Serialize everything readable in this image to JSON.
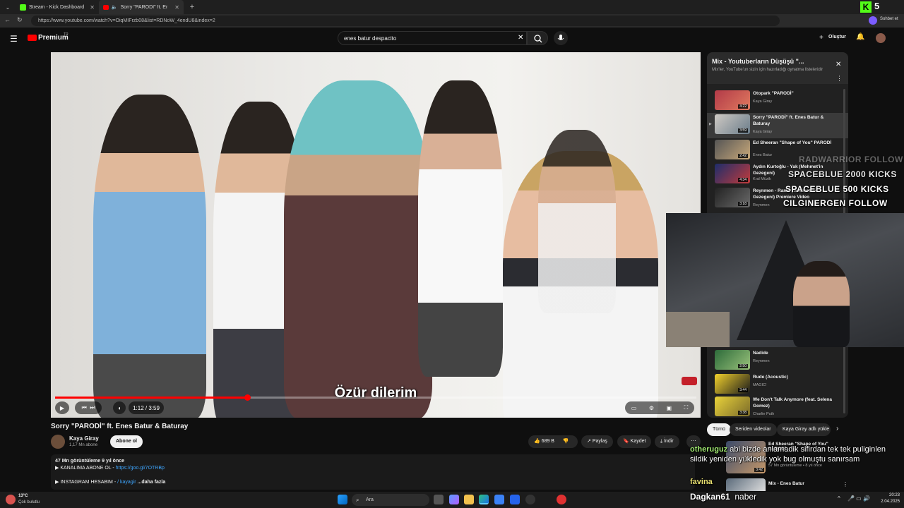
{
  "browser": {
    "tabs": [
      {
        "label": "Stream - Kick Dashboard",
        "active": false
      },
      {
        "label": "Sorry \"PARODİ\" ft. Enes Batur",
        "active": true
      }
    ],
    "url": "https://www.youtube.com/watch?v=OiqMIFrzb08&list=RDNoW_4endU8&index=2",
    "kick_badge": "5",
    "chat_button": "Sohbet et"
  },
  "youtube": {
    "logo": "Premium",
    "logo_sup": "TR",
    "search_value": "enes batur despacito",
    "create_label": "Oluştur"
  },
  "video": {
    "subtitle": "Özür dilerim",
    "time": "1:12 / 3:59",
    "progress_fraction": 0.3,
    "title": "Sorry \"PARODİ\" ft. Enes Batur & Baturay",
    "channel": "Kaya Giray",
    "subscribers": "1,17 Mn abone",
    "subscribe_label": "Abone ol",
    "likes": "689 B",
    "share_label": "Paylaş",
    "save_label": "Kaydet",
    "download_label": "İndir",
    "desc_line1": "47 Mn görüntüleme  9 yıl önce",
    "desc_line2": "▶ KANALIMA ABONE OL - ",
    "desc_link": "https://goo.gl/7OTRBp",
    "desc_line3": "▶ INSTAGRAM HESABIM - ",
    "desc_ig": "/ kayagir",
    "desc_more": "...daha fazla"
  },
  "playlist": {
    "title": "Mix - Youtuberların Düşüşü \"...",
    "subtitle": "Mix'ler, YouTube'un sizin için hazırladığı oynatma listeleridir",
    "items": [
      {
        "title": "Otopark \"PARODİ\"",
        "author": "Kaya Giray",
        "duration": "4:22"
      },
      {
        "title": "Sorry \"PARODİ\" ft. Enes Batur & Baturay",
        "author": "Kaya Giray",
        "duration": "3:59"
      },
      {
        "title": "Ed Sheeran \"Shape of You\" PARODİ",
        "author": "Enes Batur",
        "duration": "2:42"
      },
      {
        "title": "Aydın Kurtoğlu - Yak (Mehmet'in Gezegeni)",
        "author": "Kral Müzik",
        "duration": "4:34"
      },
      {
        "title": "Reynmen - Ramo (Mehmet'in Gezegeni) Premiere Video",
        "author": "Reynmen",
        "duration": "3:18"
      },
      {
        "title": "Nadide",
        "author": "Reynmen",
        "duration": "2:50"
      },
      {
        "title": "Rude (Acoustic)",
        "author": "MAGIC!",
        "duration": "3:44"
      },
      {
        "title": "We Don't Talk Anymore (feat. Selena Gomez)",
        "author": "Charlie Puth",
        "duration": "3:38"
      }
    ]
  },
  "filters": [
    "Tümü",
    "Seriden videolar",
    "Kaya Giray adlı yükle"
  ],
  "recommendations": [
    {
      "title": "Ed Sheeran \"Shape of You\" PARODİ",
      "meta": "57 Mn görüntüleme • 8 yıl önce",
      "duration": "3:42"
    },
    {
      "title": "Mix - Enes Batur",
      "meta": "",
      "duration": ""
    }
  ],
  "overlay": {
    "kick_alerts": [
      "RADWARRIOR  FOLLOW",
      "SPACEBLUE  2000 KICKS",
      "SPACEBLUE  500 KICKS",
      "CILGINERGEN  FOLLOW"
    ],
    "chat": [
      {
        "user": "otheruguz",
        "text": "abi bizde anlamadik sifirdan tek tek puliginlen sildik yeniden yükledik yok bug olmuştu sanırsam",
        "color": "#9fe870"
      },
      {
        "user": "favina",
        "text": "",
        "color": "#e8e070"
      },
      {
        "user": "Dagkan61",
        "text": "naber",
        "color": "#ffffff"
      }
    ]
  },
  "taskbar": {
    "weather_temp": "13°C",
    "weather_desc": "Çok bulutlu",
    "search_label": "Ara",
    "time": "20:23",
    "date": "2.04.2025"
  }
}
